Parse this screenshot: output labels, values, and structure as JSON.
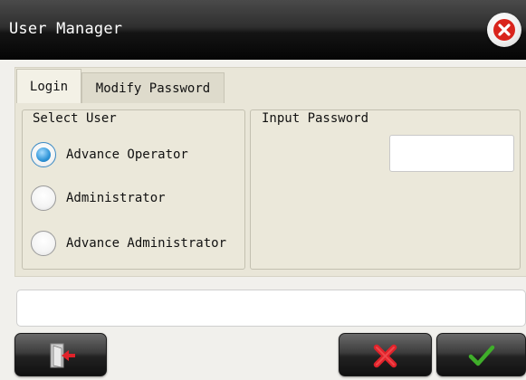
{
  "window": {
    "title": "User Manager",
    "close_icon": "close-icon"
  },
  "tabs": [
    {
      "label": "Login",
      "active": true
    },
    {
      "label": "Modify Password",
      "active": false
    }
  ],
  "select_user": {
    "legend": "Select User",
    "options": [
      {
        "label": "Advance Operator",
        "selected": true
      },
      {
        "label": "Administrator",
        "selected": false
      },
      {
        "label": "Advance Administrator",
        "selected": false
      }
    ]
  },
  "input_password": {
    "legend": "Input Password",
    "value": ""
  },
  "status": {
    "message": ""
  },
  "buttons": {
    "exit_icon": "exit-door-icon",
    "cancel_icon": "red-x-icon",
    "ok_icon": "green-check-icon"
  },
  "colors": {
    "accent_radio": "#2f95d8",
    "close_red": "#d9241c",
    "cancel_red": "#e0222a",
    "ok_green": "#3fae2a"
  }
}
